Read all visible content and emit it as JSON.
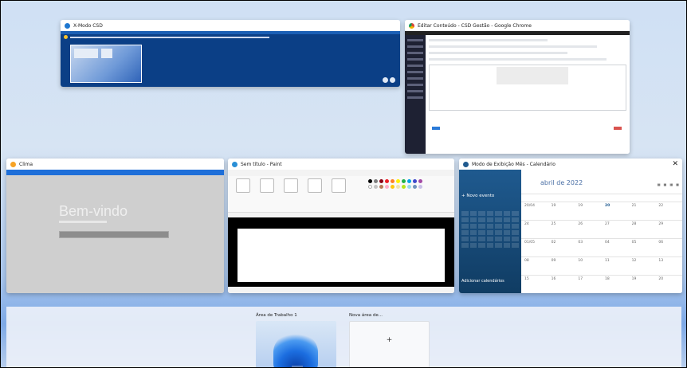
{
  "windows": {
    "w1": {
      "title": "X-Modo CSD"
    },
    "w2": {
      "title": "Editar Conteúdo - CSD Gestão - Google Chrome"
    },
    "w3": {
      "title": "Clima",
      "welcome": "Bem-vindo"
    },
    "w4": {
      "title": "Sem título - Paint"
    },
    "w5": {
      "title": "Modo de Exibição Mês - Calendário",
      "new_event": "Novo evento",
      "month": "abril de 2022",
      "add_calendars": "Adicionar calendários"
    }
  },
  "desktops": [
    {
      "label": "Área de Trabalho 1"
    },
    {
      "label": "Nova área de...",
      "add_symbol": "+"
    }
  ],
  "colors": {
    "accent": "#1f5a8f"
  }
}
